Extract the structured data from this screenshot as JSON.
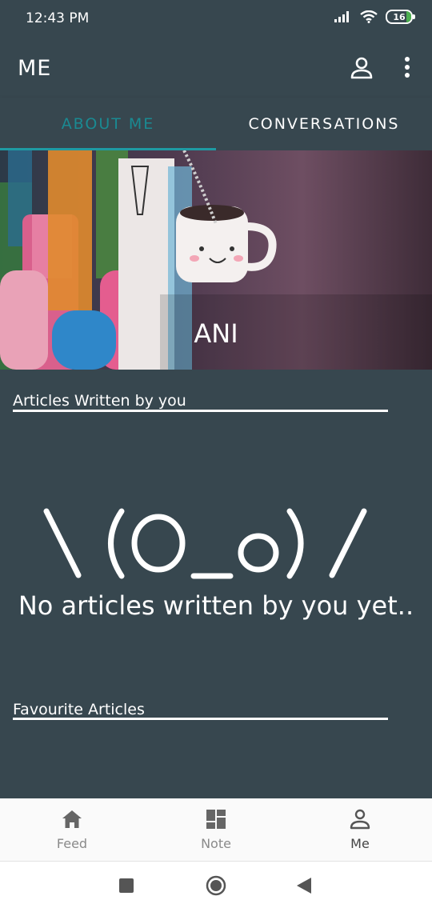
{
  "status_bar": {
    "time": "12:43 PM",
    "battery": "16"
  },
  "app_bar": {
    "title": "ME"
  },
  "tabs": [
    {
      "label": "ABOUT ME",
      "active": true
    },
    {
      "label": "CONVERSATIONS",
      "active": false
    }
  ],
  "profile": {
    "name": "ANI"
  },
  "sections": {
    "articles_written": {
      "title": "Articles Written by you"
    },
    "favourite_articles": {
      "title": "Favourite Articles"
    }
  },
  "empty_state": {
    "emoticon": "\\ (O_o) /",
    "message": "No articles written by you yet.."
  },
  "bottom_nav": [
    {
      "label": "Feed",
      "icon": "home-icon"
    },
    {
      "label": "Note",
      "icon": "dashboard-icon"
    },
    {
      "label": "Me",
      "icon": "person-icon",
      "active": true
    }
  ],
  "colors": {
    "background": "#37474f",
    "accent": "#1e9aa3",
    "nav_bg": "#fafafa"
  }
}
